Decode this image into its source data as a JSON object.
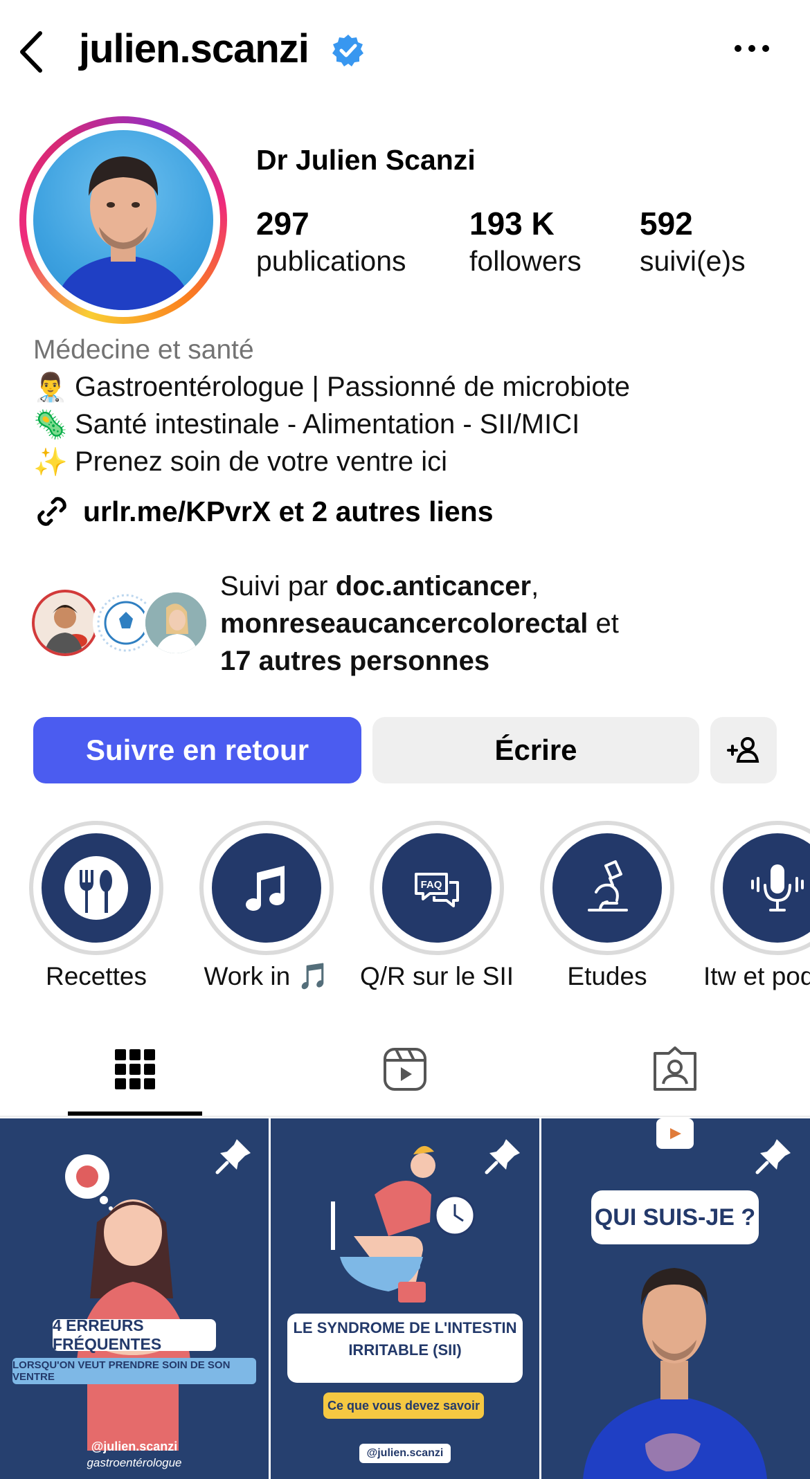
{
  "header": {
    "username": "julien.scanzi",
    "verified": true
  },
  "profile": {
    "display_name": "Dr Julien Scanzi",
    "stats": [
      {
        "value": "297",
        "label": "publications"
      },
      {
        "value": "193 K",
        "label": "followers"
      },
      {
        "value": "592",
        "label": "suivi(e)s"
      }
    ],
    "category": "Médecine et santé",
    "bio": [
      {
        "emoji": "👨‍⚕️",
        "text": "Gastroentérologue | Passionné de microbiote"
      },
      {
        "emoji": "🦠",
        "text": "Santé intestinale - Alimentation - SII/MICI"
      },
      {
        "emoji": "✨",
        "text": "Prenez soin de votre ventre ici"
      }
    ],
    "link": "urlr.me/KPvrX et 2 autres liens"
  },
  "followed_by": {
    "prefix": "Suivi par ",
    "account1": "doc.anticancer",
    "comma": ",",
    "account2": "monreseaucancercolorectal",
    "and": " et",
    "others": "17 autres personnes"
  },
  "actions": {
    "follow_back": "Suivre en retour",
    "message": "Écrire"
  },
  "highlights": [
    {
      "label": "Recettes",
      "icon": "fork-spoon-plate-icon"
    },
    {
      "label": "Work in 🎵",
      "icon": "music-note-icon"
    },
    {
      "label": "Q/R sur le SII",
      "icon": "faq-bubble-icon"
    },
    {
      "label": "Etudes",
      "icon": "microscope-icon"
    },
    {
      "label": "Itw et pod",
      "icon": "microphone-icon"
    }
  ],
  "posts": [
    {
      "title": "4 ERREURS FRÉQUENTES",
      "subtitle": "LORSQU'ON VEUT PRENDRE SOIN DE SON VENTRE",
      "handle": "@julien.scanzi",
      "caption": "gastroentérologue"
    },
    {
      "title_line1": "LE SYNDROME DE L'INTESTIN",
      "title_line2": "IRRITABLE (SII)",
      "subtitle": "Ce que vous devez savoir",
      "handle": "@julien.scanzi"
    },
    {
      "title": "QUI SUIS-JE ?"
    }
  ],
  "colors": {
    "accent_button": "#4b5cf0",
    "verified": "#3897f0",
    "post_bg": "#23396a"
  }
}
